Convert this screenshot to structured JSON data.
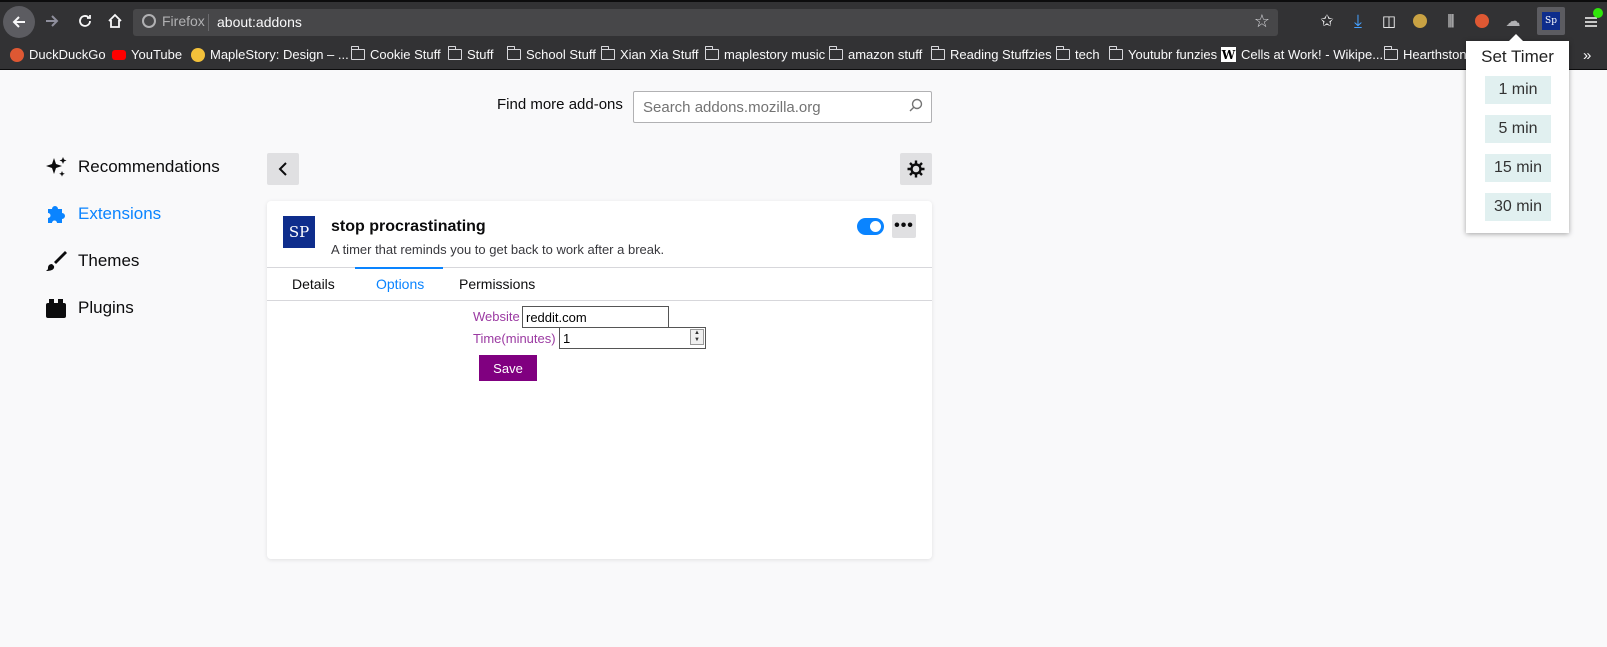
{
  "browser": {
    "identity_label": "Firefox",
    "url": "about:addons"
  },
  "bookmarks": [
    {
      "label": "DuckDuckGo",
      "icon": "duckduckgo-icon"
    },
    {
      "label": "YouTube",
      "icon": "youtube-icon"
    },
    {
      "label": "MapleStory: Design – ...",
      "icon": "maplestory-icon"
    },
    {
      "label": "Cookie Stuff",
      "icon": "folder-icon"
    },
    {
      "label": "Stuff",
      "icon": "folder-icon"
    },
    {
      "label": "School Stuff",
      "icon": "folder-icon"
    },
    {
      "label": "Xian Xia Stuff",
      "icon": "folder-icon"
    },
    {
      "label": "maplestory music",
      "icon": "folder-icon"
    },
    {
      "label": "amazon stuff",
      "icon": "folder-icon"
    },
    {
      "label": "Reading Stuffzies",
      "icon": "folder-icon"
    },
    {
      "label": "tech",
      "icon": "folder-icon"
    },
    {
      "label": "Youtubr funzies",
      "icon": "folder-icon"
    },
    {
      "label": "Cells at Work! - Wikipe...",
      "icon": "wikipedia-icon"
    },
    {
      "label": "Hearthstone",
      "icon": "folder-icon"
    }
  ],
  "search": {
    "label": "Find more add-ons",
    "placeholder": "Search addons.mozilla.org"
  },
  "sidebar": {
    "items": [
      {
        "label": "Recommendations",
        "icon": "sparkle-icon"
      },
      {
        "label": "Extensions",
        "icon": "puzzle-icon"
      },
      {
        "label": "Themes",
        "icon": "brush-icon"
      },
      {
        "label": "Plugins",
        "icon": "plugin-icon"
      }
    ]
  },
  "extension": {
    "logo_text": "SP",
    "name": "stop procrastinating",
    "description": "A timer that reminds you to get back to work after a break.",
    "enabled": true,
    "tabs": [
      "Details",
      "Options",
      "Permissions"
    ],
    "active_tab": "Options"
  },
  "options": {
    "website_label": "Website",
    "website_value": "reddit.com",
    "time_label": "Time(minutes)",
    "time_value": "1",
    "save_label": "Save"
  },
  "popup": {
    "title": "Set Timer",
    "buttons": [
      "1 min",
      "5 min",
      "15 min",
      "30 min"
    ]
  },
  "colors": {
    "accent": "#0a84ff",
    "toolbar": "#323234",
    "save_button": "#800080",
    "option_label": "#9b3aa2"
  }
}
